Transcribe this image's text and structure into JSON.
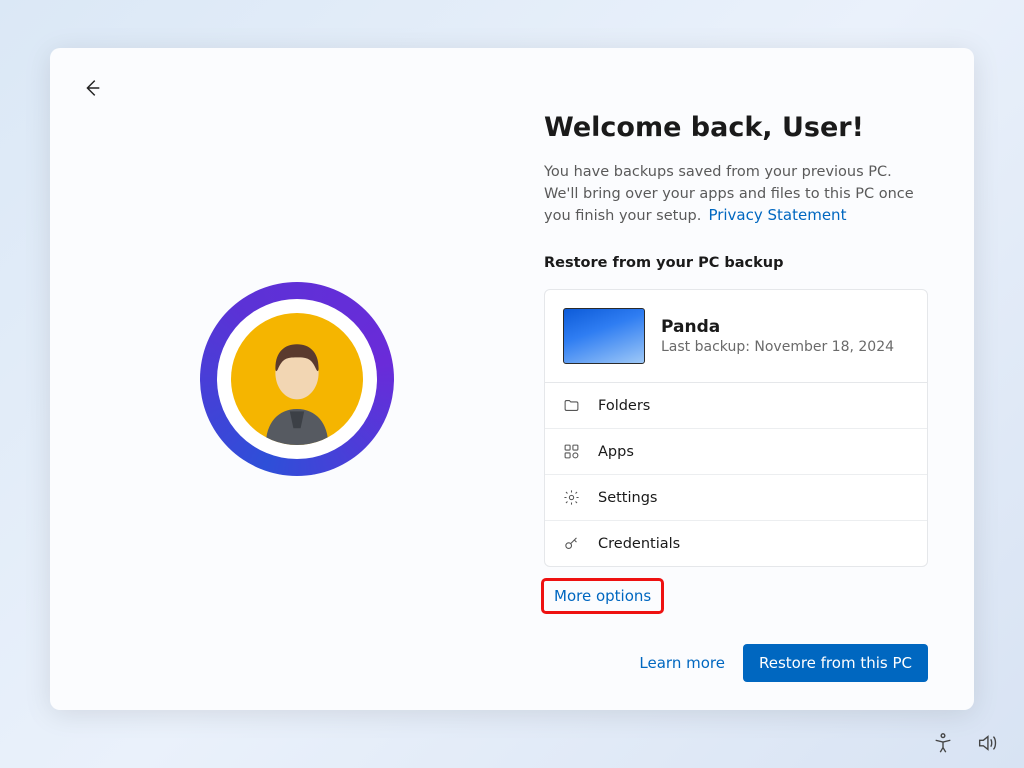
{
  "header": {
    "title": "Welcome back, User!",
    "description": "You have backups saved from your previous PC. We'll bring over your apps and files to this PC once you finish your setup.",
    "privacy_link": "Privacy Statement"
  },
  "restore": {
    "section_label": "Restore from your PC backup",
    "pc_name": "Panda",
    "last_backup": "Last backup: November 18, 2024",
    "items": [
      {
        "icon": "folder-icon",
        "label": "Folders"
      },
      {
        "icon": "apps-icon",
        "label": "Apps"
      },
      {
        "icon": "settings-icon",
        "label": "Settings"
      },
      {
        "icon": "key-icon",
        "label": "Credentials"
      }
    ],
    "more_options": "More options"
  },
  "footer": {
    "learn_more": "Learn more",
    "restore_button": "Restore from this PC"
  },
  "colors": {
    "accent": "#0067c0",
    "highlight_outline": "#e11"
  }
}
